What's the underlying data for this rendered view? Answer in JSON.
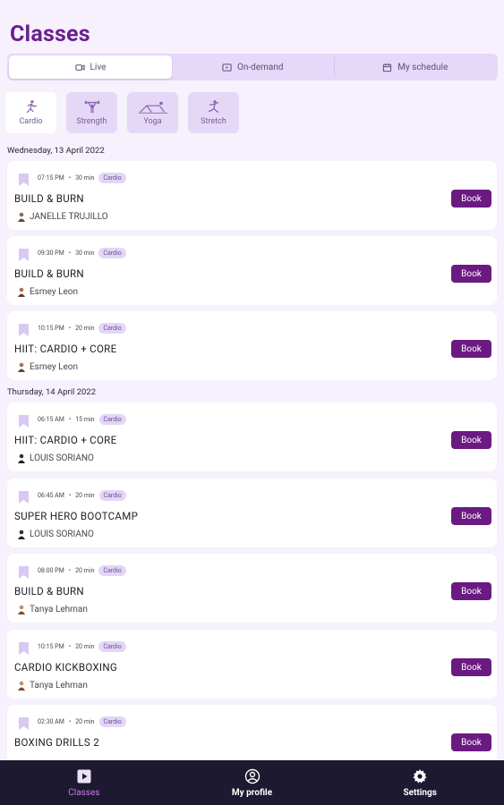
{
  "header": {
    "title": "Classes"
  },
  "tabs": [
    {
      "label": "Live",
      "icon": "live-icon",
      "active": true
    },
    {
      "label": "On-demand",
      "icon": "on-demand-icon",
      "active": false
    },
    {
      "label": "My schedule",
      "icon": "calendar-icon",
      "active": false
    }
  ],
  "categories": [
    {
      "label": "Cardio",
      "icon": "cardio-icon",
      "active": true
    },
    {
      "label": "Strength",
      "icon": "strength-icon",
      "active": false
    },
    {
      "label": "Yoga",
      "icon": "yoga-icon",
      "active": false
    },
    {
      "label": "Stretch",
      "icon": "stretch-icon",
      "active": false
    }
  ],
  "days": [
    {
      "label": "Wednesday, 13 April 2022"
    },
    {
      "label": "Thursday, 14 April 2022"
    }
  ],
  "classes": [
    {
      "time": "07:15 PM",
      "duration": "30 min",
      "category": "Cardio",
      "name": "BUILD & BURN",
      "instructor": "JANELLE TRUJILLO",
      "book_label": "Book"
    },
    {
      "time": "09:30 PM",
      "duration": "30 min",
      "category": "Cardio",
      "name": "BUILD & BURN",
      "instructor": "Esmey Leon",
      "book_label": "Book"
    },
    {
      "time": "10:15 PM",
      "duration": "20 min",
      "category": "Cardio",
      "name": "HIIT: CARDIO + CORE",
      "instructor": "Esmey Leon",
      "book_label": "Book"
    },
    {
      "time": "06:15 AM",
      "duration": "15 min",
      "category": "Cardio",
      "name": "HIIT: CARDIO + CORE",
      "instructor": "LOUIS SORIANO",
      "book_label": "Book"
    },
    {
      "time": "06:45 AM",
      "duration": "20 min",
      "category": "Cardio",
      "name": "SUPER HERO BOOTCAMP",
      "instructor": "LOUIS SORIANO",
      "book_label": "Book"
    },
    {
      "time": "08:00 PM",
      "duration": "20 min",
      "category": "Cardio",
      "name": "BUILD & BURN",
      "instructor": "Tanya Lehman",
      "book_label": "Book"
    },
    {
      "time": "10:15 PM",
      "duration": "20 min",
      "category": "Cardio",
      "name": "CARDIO KICKBOXING",
      "instructor": "Tanya Lehman",
      "book_label": "Book"
    },
    {
      "time": "02:30 AM",
      "duration": "20 min",
      "category": "Cardio",
      "name": "BOXING DRILLS 2",
      "instructor": "",
      "book_label": "Book"
    }
  ],
  "bottom_nav": [
    {
      "label": "Classes",
      "icon": "play-square-icon",
      "active": true
    },
    {
      "label": "My profile",
      "icon": "profile-icon",
      "active": false
    },
    {
      "label": "Settings",
      "icon": "gear-icon",
      "active": false
    }
  ],
  "colors": {
    "accent": "#6b1a82",
    "title": "#6a1f8f",
    "background": "#f6f1fc",
    "nav_bg": "#1c1930"
  }
}
